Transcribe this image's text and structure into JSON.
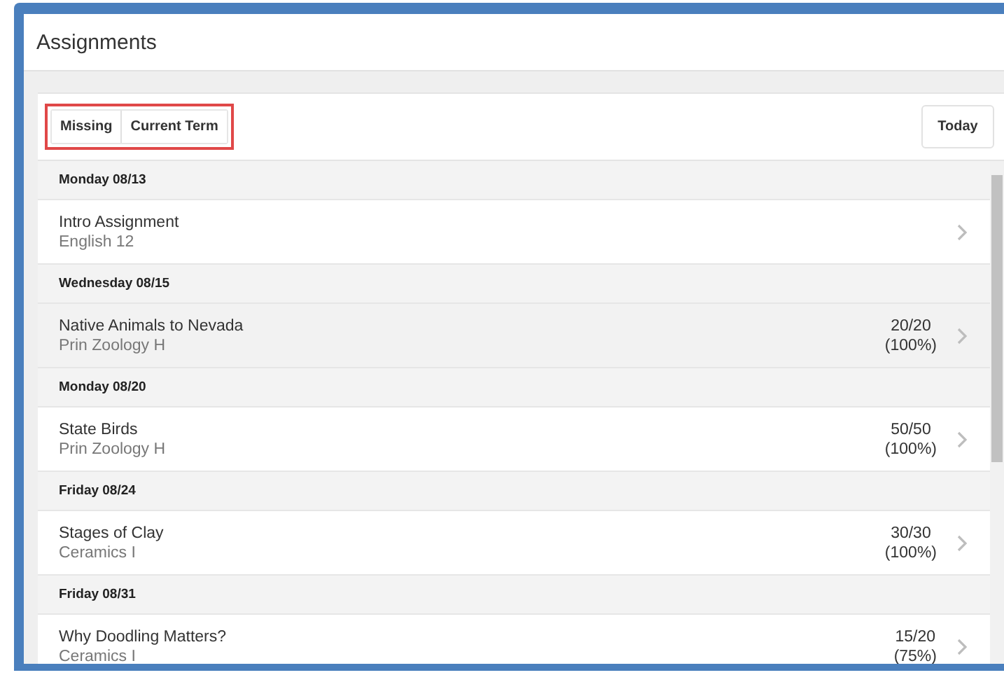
{
  "page": {
    "title": "Assignments"
  },
  "filters": [
    {
      "label": "Missing",
      "selected": false
    },
    {
      "label": "Current Term",
      "selected": false
    }
  ],
  "filters_highlighted": true,
  "today_button": "Today",
  "groups": [
    {
      "date": "Monday 08/13",
      "items": [
        {
          "name": "Intro Assignment",
          "course": "English 12",
          "hovered": false
        }
      ]
    },
    {
      "date": "Wednesday 08/15",
      "items": [
        {
          "name": "Native Animals to Nevada",
          "course": "Prin Zoology H",
          "score": "20/20",
          "percent": "(100%)",
          "hovered": true
        }
      ]
    },
    {
      "date": "Monday 08/20",
      "items": [
        {
          "name": "State Birds",
          "course": "Prin Zoology H",
          "score": "50/50",
          "percent": "(100%)",
          "hovered": false
        }
      ]
    },
    {
      "date": "Friday 08/24",
      "items": [
        {
          "name": "Stages of Clay",
          "course": "Ceramics I",
          "score": "30/30",
          "percent": "(100%)",
          "hovered": false
        }
      ]
    },
    {
      "date": "Friday 08/31",
      "items": [
        {
          "name": "Why Doodling Matters?",
          "course": "Ceramics I",
          "score": "15/20",
          "percent": "(75%)",
          "hovered": false
        }
      ]
    }
  ]
}
